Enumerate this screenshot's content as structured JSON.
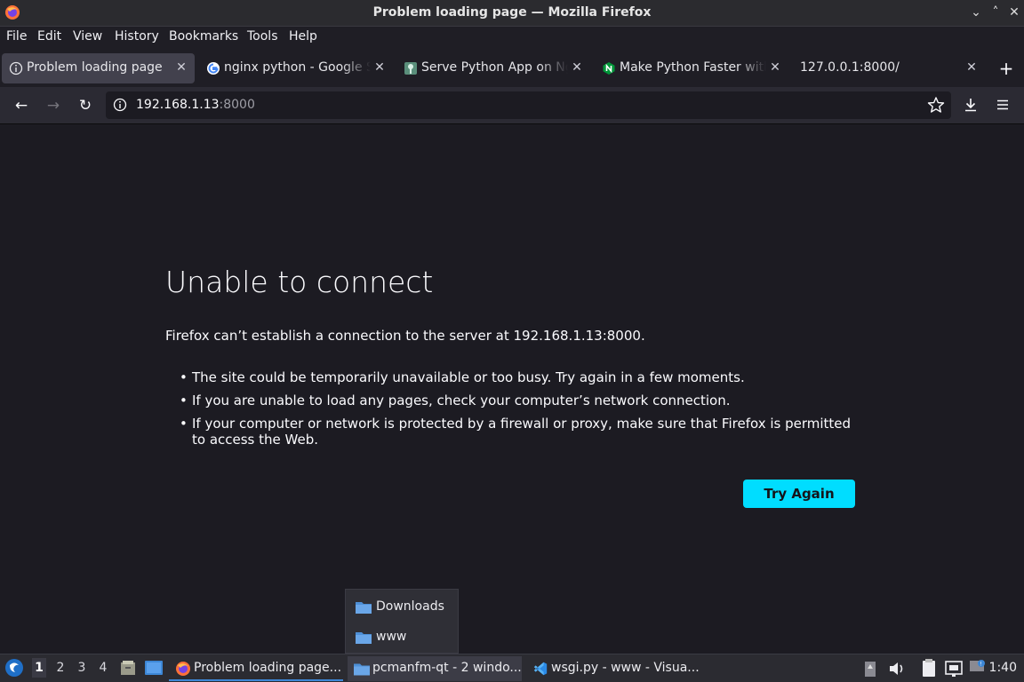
{
  "window": {
    "title": "Problem loading page — Mozilla Firefox"
  },
  "menubar": [
    "File",
    "Edit",
    "View",
    "History",
    "Bookmarks",
    "Tools",
    "Help"
  ],
  "tabs": [
    {
      "label": "Problem loading page"
    },
    {
      "label": "nginx python - Google Se"
    },
    {
      "label": "Serve Python App on Ngi"
    },
    {
      "label": "Make Python Faster with"
    },
    {
      "label": "127.0.0.1:8000/"
    }
  ],
  "urlbar": {
    "host": "192.168.1.13",
    "port": ":8000"
  },
  "error": {
    "title": "Unable to connect",
    "message": "Firefox can’t establish a connection to the server at 192.168.1.13:8000.",
    "items": [
      "The site could be temporarily unavailable or too busy. Try again in a few moments.",
      "If you are unable to load any pages, check your computer’s network connection.",
      "If your computer or network is protected by a firewall or proxy, make sure that Firefox is permitted to access the Web."
    ],
    "button": "Try Again"
  },
  "popup": [
    "Downloads",
    "www"
  ],
  "taskbar": {
    "workspaces": [
      "1",
      "2",
      "3",
      "4"
    ],
    "tasks": [
      "Problem loading page...",
      "pcmanfm-qt - 2 windo...",
      "wsgi.py - www - Visua..."
    ],
    "clock": "1:40"
  }
}
